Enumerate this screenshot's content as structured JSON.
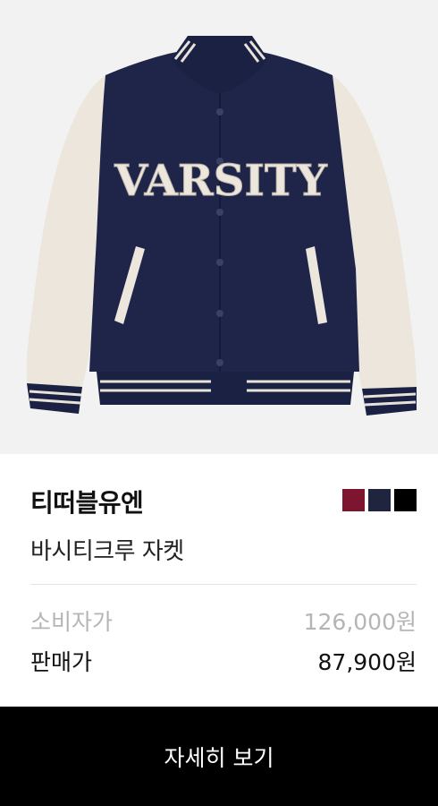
{
  "product": {
    "image_alt": "varsity jacket",
    "jacket_lettering": "VARSITY",
    "brand": "티떠블유엔",
    "name": "바시티크루 자켓",
    "colors": [
      {
        "name": "burgundy",
        "hex": "#7d1430"
      },
      {
        "name": "navy",
        "hex": "#20253f"
      },
      {
        "name": "black",
        "hex": "#000000"
      }
    ]
  },
  "pricing": {
    "retail_label": "소비자가",
    "retail_price": "126,000원",
    "sale_label": "판매가",
    "sale_price": "87,900원"
  },
  "cta": {
    "label": "자세히 보기"
  },
  "theme": {
    "accent": "#000000",
    "muted_text": "#b5b5b5",
    "image_bg": "#f2f2f2"
  }
}
